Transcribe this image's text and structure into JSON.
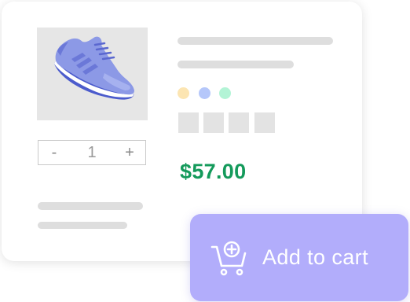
{
  "product": {
    "image_icon": "sneaker-icon",
    "quantity": {
      "minus_label": "-",
      "value": "1",
      "plus_label": "+"
    },
    "color_options": [
      "#fce5b2",
      "#b5c7fa",
      "#b3f4d6"
    ],
    "price": "$57.00",
    "price_color": "#149a5b"
  },
  "actions": {
    "add_to_cart_label": "Add to cart",
    "add_to_cart_icon": "cart-add-icon",
    "button_color": "#b2adfb"
  }
}
